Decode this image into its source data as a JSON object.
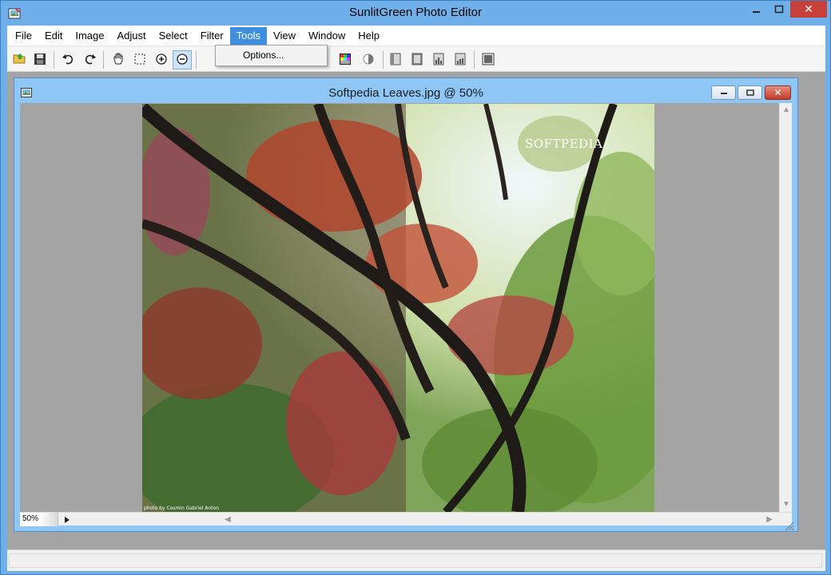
{
  "app": {
    "title": "SunlitGreen Photo Editor",
    "controls": {
      "minimize": "—",
      "maximize": "□",
      "close": "✕"
    }
  },
  "menu": {
    "items": [
      "File",
      "Edit",
      "Image",
      "Adjust",
      "Select",
      "Filter",
      "Tools",
      "View",
      "Window",
      "Help"
    ],
    "active": "Tools"
  },
  "tools_menu": {
    "items": [
      "Options..."
    ]
  },
  "toolbar": {
    "buttons": [
      {
        "icon": "open-folder-icon"
      },
      {
        "icon": "save-icon"
      },
      {
        "icon": "undo-icon"
      },
      {
        "icon": "redo-icon"
      },
      {
        "icon": "hand-pan-icon"
      },
      {
        "icon": "rect-select-icon"
      },
      {
        "icon": "zoom-in-icon"
      },
      {
        "icon": "zoom-out-icon",
        "pressed": true
      },
      {
        "icon": "color-grid-icon"
      },
      {
        "icon": "palette-icon"
      },
      {
        "icon": "contrast-icon"
      },
      {
        "icon": "frame-left-icon"
      },
      {
        "icon": "frame-full-icon"
      },
      {
        "icon": "histogram-icon"
      },
      {
        "icon": "histogram-alt-icon"
      },
      {
        "icon": "fit-window-icon"
      }
    ]
  },
  "document": {
    "title": "Softpedia Leaves.jpg @ 50%",
    "zoom": "50%",
    "watermark": "SOFTPEDIA",
    "photo_credit": "photo by Cosmin Gabriel Anton"
  },
  "colors": {
    "window_frame": "#6fb0ea",
    "doc_frame": "#8ec7f6",
    "menu_active": "#3f8fe0",
    "close_button": "#c7403a",
    "workspace": "#a4a4a4"
  }
}
